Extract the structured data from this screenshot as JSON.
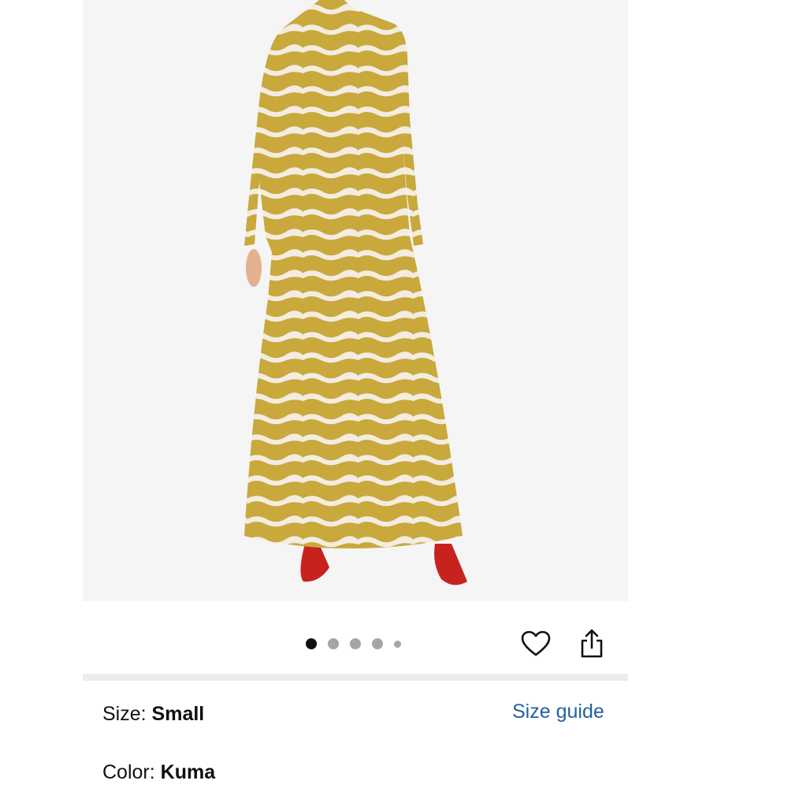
{
  "product": {
    "image_alt": "Zebra print long sleeve maxi dress",
    "dress_color": "#c9a83c",
    "stripe_color": "#f3ece0",
    "shoe_color": "#c8221f"
  },
  "carousel": {
    "dots": [
      {
        "active": true,
        "small": false
      },
      {
        "active": false,
        "small": false
      },
      {
        "active": false,
        "small": false
      },
      {
        "active": false,
        "small": false
      },
      {
        "active": false,
        "small": true
      }
    ]
  },
  "actions": {
    "favorite_icon": "heart-icon",
    "share_icon": "share-icon"
  },
  "size": {
    "label": "Size:",
    "value": "Small",
    "guide_link": "Size guide"
  },
  "color": {
    "label": "Color:",
    "value": "Kuma"
  }
}
